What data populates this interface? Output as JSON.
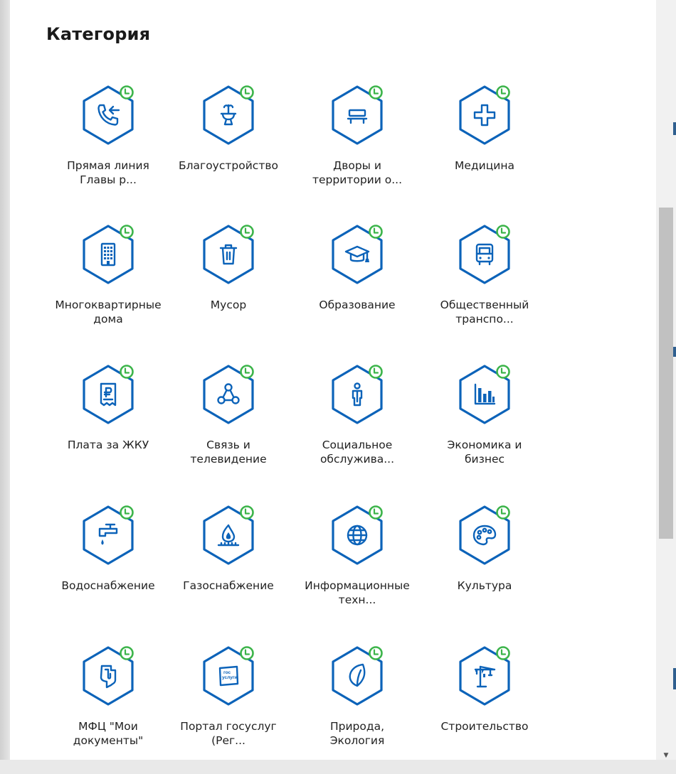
{
  "title": "Категория",
  "colors": {
    "icon_blue": "#0c63b9",
    "badge_green": "#3cb44a"
  },
  "categories": [
    {
      "label": "Прямая линия\nГлавы р...",
      "icon": "phone-incoming-icon"
    },
    {
      "label": "Благоустройство",
      "icon": "fountain-icon"
    },
    {
      "label": "Дворы и\nтерритории о...",
      "icon": "bench-icon"
    },
    {
      "label": "Медицина",
      "icon": "medical-cross-icon"
    },
    {
      "label": "Многоквартирные\nдома",
      "icon": "apartment-building-icon"
    },
    {
      "label": "Мусор",
      "icon": "trash-bin-icon"
    },
    {
      "label": "Образование",
      "icon": "graduation-cap-icon"
    },
    {
      "label": "Общественный\nтранспо...",
      "icon": "bus-icon"
    },
    {
      "label": "Плата за ЖКУ",
      "icon": "ruble-receipt-icon"
    },
    {
      "label": "Связь и\nтелевидение",
      "icon": "network-nodes-icon"
    },
    {
      "label": "Социальное\nобслужива...",
      "icon": "person-icon"
    },
    {
      "label": "Экономика и\nбизнес",
      "icon": "bar-chart-icon"
    },
    {
      "label": "Водоснабжение",
      "icon": "water-tap-icon"
    },
    {
      "label": "Газоснабжение",
      "icon": "gas-flame-icon"
    },
    {
      "label": "Информационные\nтехн...",
      "icon": "globe-icon"
    },
    {
      "label": "Культура",
      "icon": "palette-icon"
    },
    {
      "label": "МФЦ \"Мои\nдокументы\"",
      "icon": "mfc-logo-icon"
    },
    {
      "label": "Портал госуслуг\n(Рег...",
      "icon": "gosuslugi-logo-icon",
      "logo_text": [
        "гос",
        "услуги"
      ]
    },
    {
      "label": "Природа,\nЭкология",
      "icon": "leaf-icon"
    },
    {
      "label": "Строительство",
      "icon": "construction-crane-icon"
    }
  ]
}
